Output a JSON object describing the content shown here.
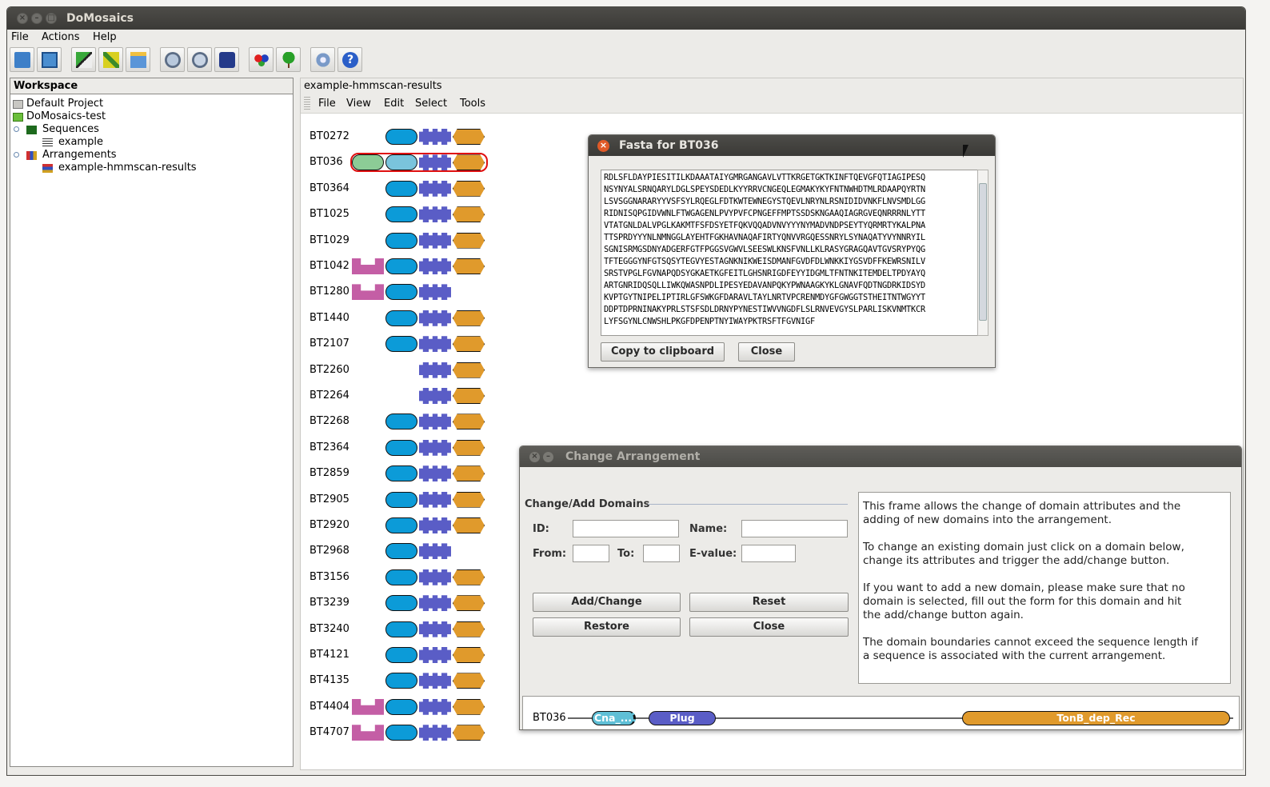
{
  "app": {
    "title": "DoMosaics"
  },
  "menubar": {
    "file": "File",
    "actions": "Actions",
    "help": "Help"
  },
  "workspace": {
    "title": "Workspace",
    "items": [
      {
        "label": "Default Project"
      },
      {
        "label": "DoMosaics-test"
      },
      {
        "label": "Sequences"
      },
      {
        "label": "example"
      },
      {
        "label": "Arrangements"
      },
      {
        "label": "example-hmmscan-results"
      }
    ]
  },
  "view": {
    "title": "example-hmmscan-results",
    "menu": {
      "file": "File",
      "view": "View",
      "edit": "Edit",
      "select": "Select",
      "tools": "Tools"
    },
    "proteins": [
      {
        "id": "BT0272",
        "domains": [
          "blue",
          "purple",
          "orange"
        ]
      },
      {
        "id": "BT036",
        "domains": [
          "green",
          "blue",
          "purple",
          "orange"
        ],
        "selected": true
      },
      {
        "id": "BT0364",
        "domains": [
          "blue",
          "purple",
          "orange"
        ]
      },
      {
        "id": "BT1025",
        "domains": [
          "blue",
          "purple",
          "orange"
        ]
      },
      {
        "id": "BT1029",
        "domains": [
          "blue",
          "purple",
          "orange"
        ]
      },
      {
        "id": "BT1042",
        "domains": [
          "pink",
          "blue",
          "purple",
          "orange"
        ]
      },
      {
        "id": "BT1280",
        "domains": [
          "pink",
          "blue",
          "purple"
        ]
      },
      {
        "id": "BT1440",
        "domains": [
          "blue",
          "purple",
          "orange"
        ]
      },
      {
        "id": "BT2107",
        "domains": [
          "blue",
          "purple",
          "orange"
        ]
      },
      {
        "id": "BT2260",
        "domains": [
          "purple",
          "orange"
        ]
      },
      {
        "id": "BT2264",
        "domains": [
          "purple",
          "orange"
        ]
      },
      {
        "id": "BT2268",
        "domains": [
          "blue",
          "purple",
          "orange"
        ]
      },
      {
        "id": "BT2364",
        "domains": [
          "blue",
          "purple",
          "orange"
        ]
      },
      {
        "id": "BT2859",
        "domains": [
          "blue",
          "purple",
          "orange"
        ]
      },
      {
        "id": "BT2905",
        "domains": [
          "blue",
          "purple",
          "orange"
        ]
      },
      {
        "id": "BT2920",
        "domains": [
          "blue",
          "purple",
          "orange"
        ]
      },
      {
        "id": "BT2968",
        "domains": [
          "blue",
          "purple"
        ]
      },
      {
        "id": "BT3156",
        "domains": [
          "blue",
          "purple",
          "orange"
        ]
      },
      {
        "id": "BT3239",
        "domains": [
          "blue",
          "purple",
          "orange"
        ]
      },
      {
        "id": "BT3240",
        "domains": [
          "blue",
          "purple",
          "orange"
        ]
      },
      {
        "id": "BT4121",
        "domains": [
          "blue",
          "purple",
          "orange"
        ]
      },
      {
        "id": "BT4135",
        "domains": [
          "blue",
          "purple",
          "orange"
        ]
      },
      {
        "id": "BT4404",
        "domains": [
          "pink",
          "blue",
          "purple",
          "orange"
        ]
      },
      {
        "id": "BT4707",
        "domains": [
          "pink",
          "blue",
          "purple",
          "orange"
        ]
      }
    ]
  },
  "fasta": {
    "title": "Fasta for BT036",
    "lines": [
      "RDLSFLDAYPIESITILKDAAATAIYGMRGANGAVLVTTKRGETGKTKINFTQEVGFQTIAGIPESQ",
      "NSYNYALSRNQARYLDGLSPEYSDEDLKYYRRVCNGEQLEGMAKYKYFNTNWHDTMLRDAAPQYRTN",
      "LSVSGGNARARYYVSFSYLRQEGLFDTKWTEWNEGYSTQEVLNRYNLRSNIDIDVNKFLNVSMDLGG",
      "RIDNISQPGIDVWNLFTWGAGENLPVYPVFCPNGEFFMPTSSDSKNGAAQIAGRGVEQNRRRNLYTT",
      "VTATGNLDALVPGLKAKMTFSFDSYETFQKVQQADVNVYYYNYMADVNDPSEYTYQRMRTYKALPNA",
      "TTSPRDYYYNLNMNGGLAYEHTFGKHAVNAQAFIRTYQNVVRGQESSNRYLSYNAQATYVYNNRYIL",
      "SGNISRMGSDNYADGERFGTFPGGSVGWVLSEESWLKNSFVNLLKLRASYGRAGQAVTGVSRYPYQG",
      "TFTEGGGYNFGTSQSYTEGVYESTAGNKNIKWEISDMANFGVDFDLWNKKIYGSVDFFKEWRSNILV",
      "SRSTVPGLFGVNAPQDSYGKAETKGFEITLGHSNRIGDFEYYIDGMLTFNTNKITEMDELTPDYAYQ",
      "ARTGNRIDQSQLLIWKQWASNPDLIPESYEDAVANPQKYPWNAAGKYKLGNAVFQDTNGDRKIDSYD",
      "KVPTGYTNIPELIPTIRLGFSWKGFDARAVLTAYLNRTVPCRENMDYGFGWGGTSTHEITNTWGYYT",
      "DDPTDPRNINAKYPRLSTSFSDLDRNYPYNESTIWVVNGDFLSLRNVEVGYSLPARLISKVNMTKCR",
      "LYFSGYNLCNWSHLPKGFDPENPTNYIWAYPKTRSFTFGVNIGF"
    ],
    "copy_label": "Copy to clipboard",
    "close_label": "Close"
  },
  "change": {
    "title": "Change Arrangement",
    "section": "Change/Add Domains",
    "id_label": "ID:",
    "name_label": "Name:",
    "from_label": "From:",
    "to_label": "To:",
    "evalue_label": "E-value:",
    "id_value": "",
    "name_value": "",
    "from_value": "",
    "to_value": "",
    "evalue_value": "",
    "add_label": "Add/Change",
    "reset_label": "Reset",
    "restore_label": "Restore",
    "close_label": "Close",
    "help": [
      "This frame allows the change of domain attributes and the adding of new domains into the arrangement.",
      "To change an existing domain just click on a domain below, change its attributes and trigger the add/change button.",
      "If you want to add a new domain, please make sure that no domain is selected, fill out the form for this domain and hit the add/change button again.",
      "The domain boundaries cannot exceed the sequence length if a sequence is associated with the current arrangement."
    ],
    "arrangement": {
      "id": "BT036",
      "domains": [
        {
          "name": "Cna_...",
          "color": "#5fbfd6"
        },
        {
          "name": "Plug",
          "color": "#5a5dc6"
        },
        {
          "name": "TonB_dep_Rec",
          "color": "#e09a2c"
        }
      ]
    }
  },
  "colors": {
    "blue": "#0c9bd8",
    "purple": "#5a5dc6",
    "orange": "#e09a2c",
    "pink": "#c45ea5",
    "green": "#8ccc96",
    "selection": "#e01010"
  }
}
